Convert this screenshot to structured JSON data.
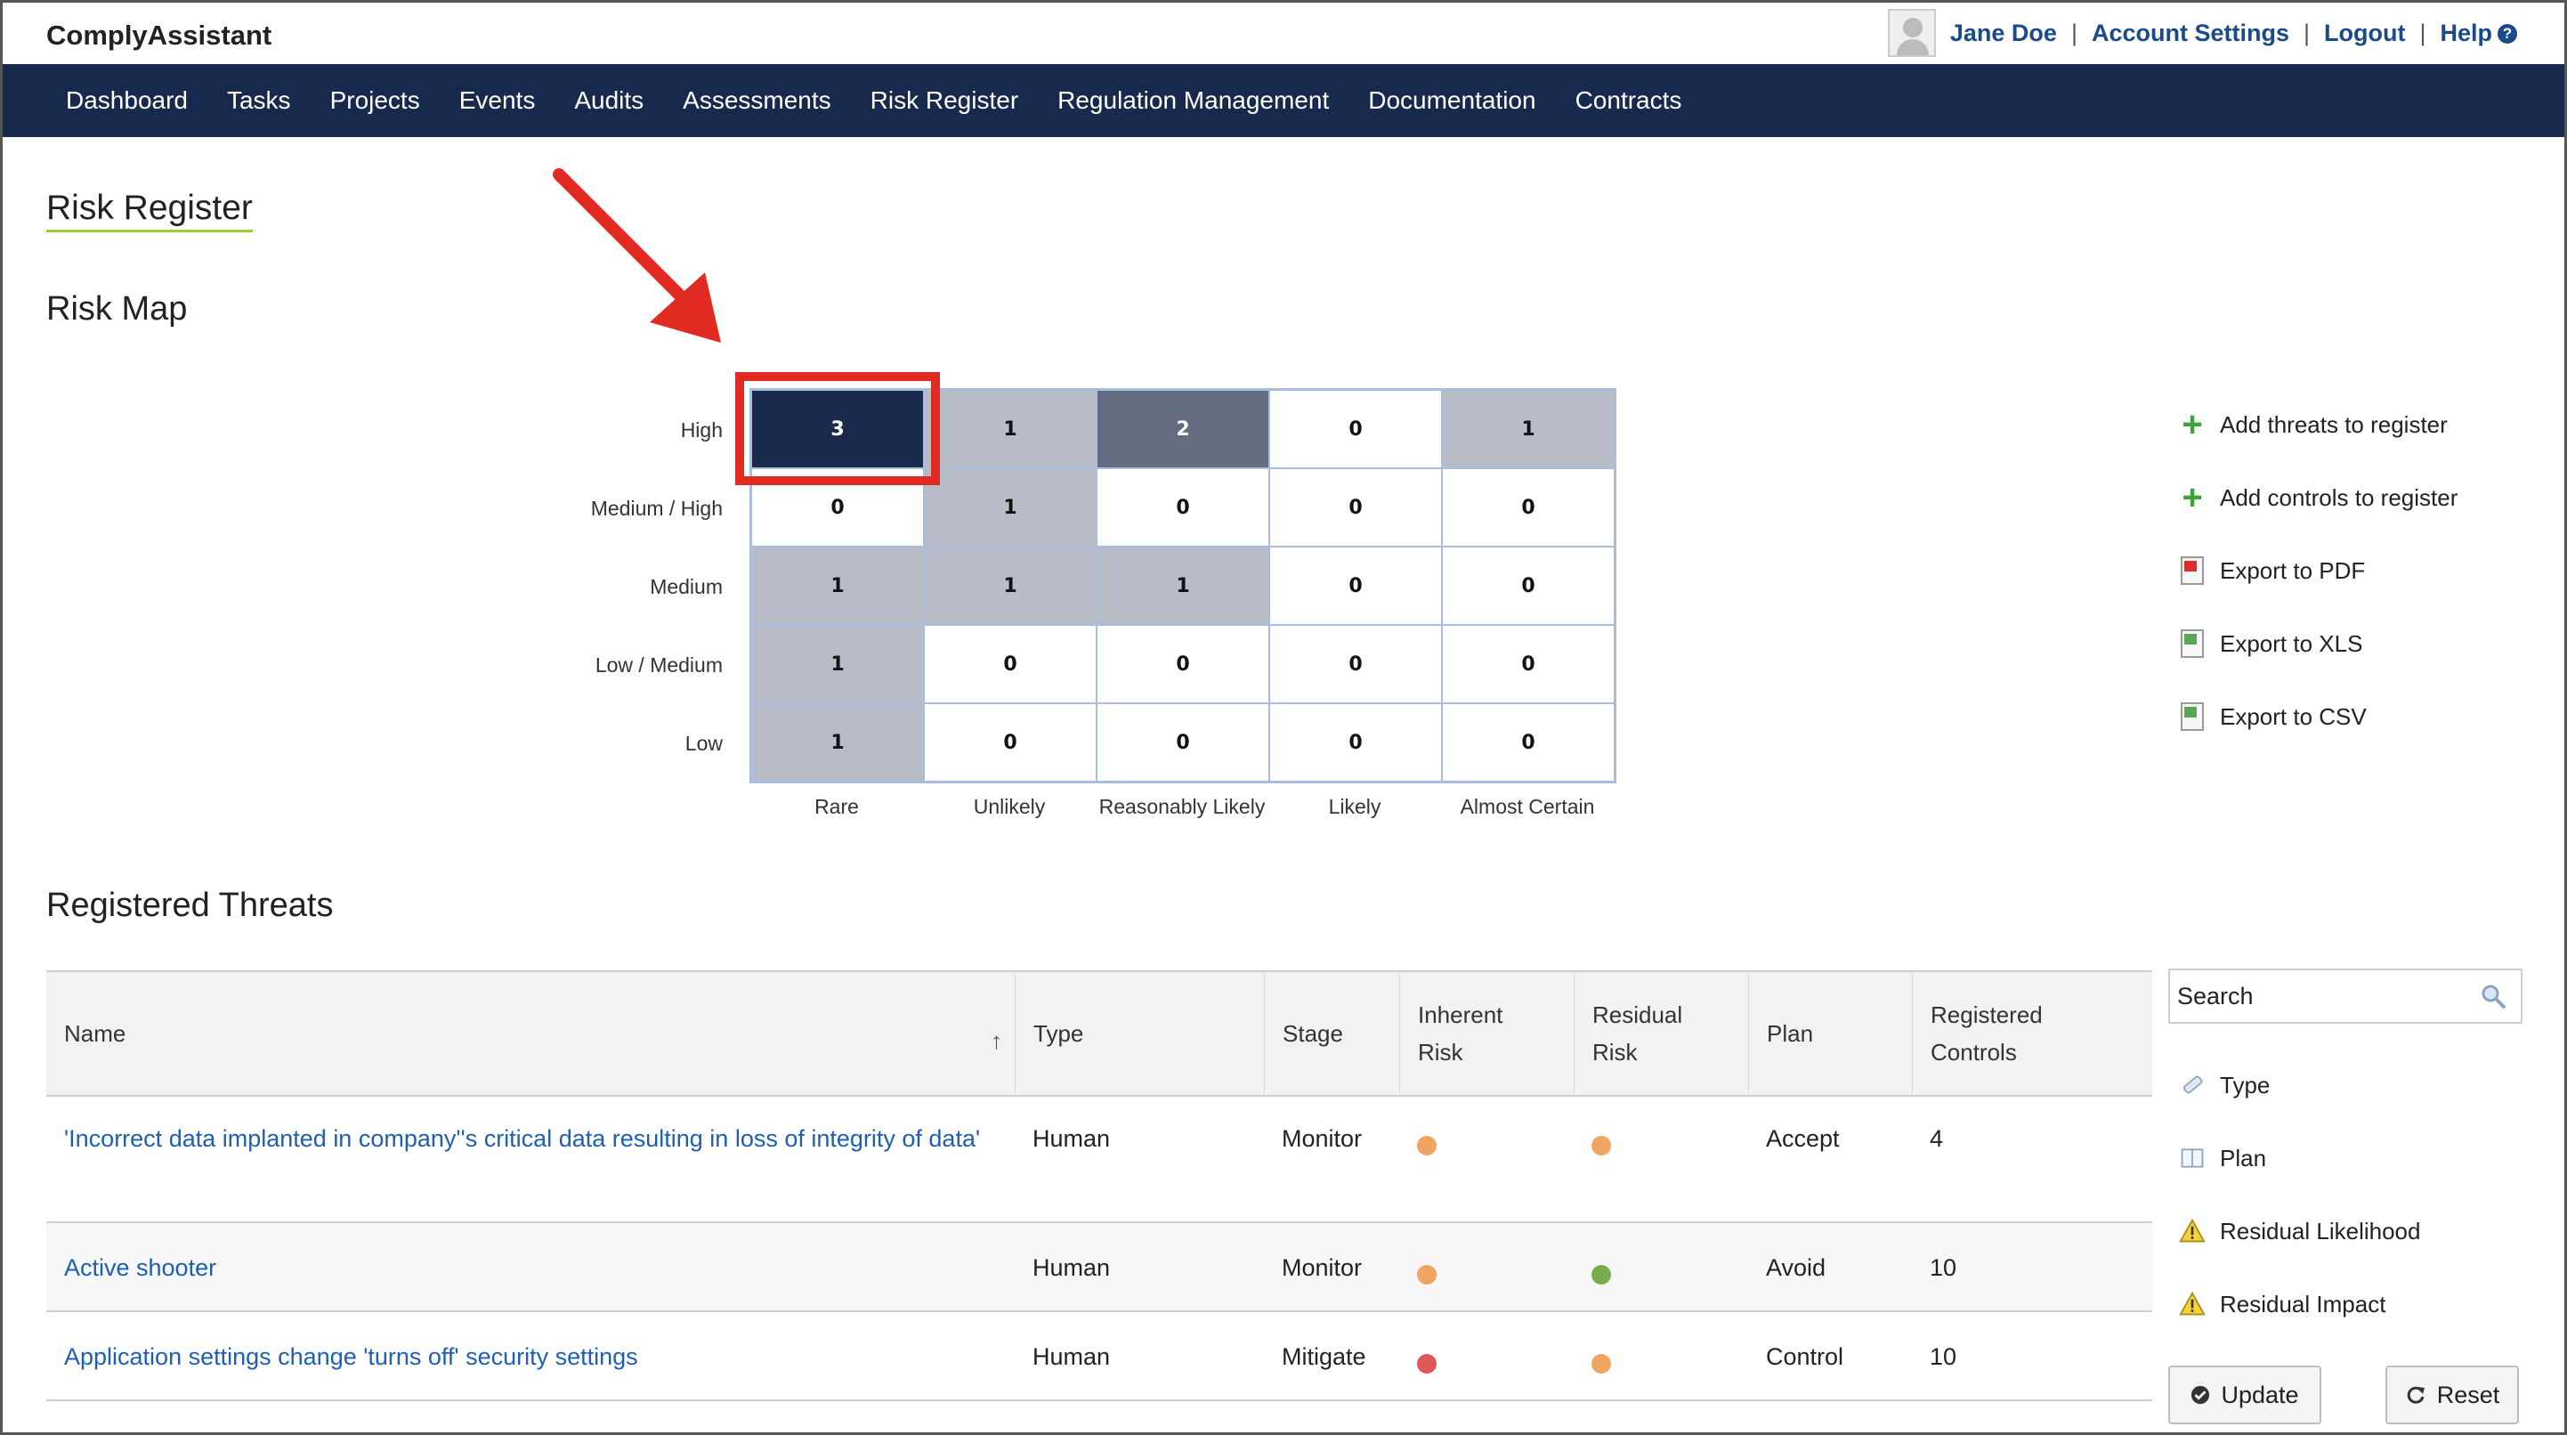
{
  "app": {
    "brand": "ComplyAssistant"
  },
  "user": {
    "name": "Jane Doe",
    "account_settings": "Account Settings",
    "logout": "Logout",
    "help": "Help",
    "sep": "|"
  },
  "nav": [
    "Dashboard",
    "Tasks",
    "Projects",
    "Events",
    "Audits",
    "Assessments",
    "Risk Register",
    "Regulation Management",
    "Documentation",
    "Contracts"
  ],
  "page": {
    "title": "Risk Register",
    "risk_map_title": "Risk Map",
    "threats_title": "Registered Threats"
  },
  "risk_map": {
    "rows": [
      "High",
      "Medium / High",
      "Medium",
      "Low / Medium",
      "Low"
    ],
    "cols": [
      "Rare",
      "Unlikely",
      "Reasonably Likely",
      "Likely",
      "Almost Certain"
    ],
    "values": [
      [
        "3",
        "1",
        "2",
        "0",
        "1"
      ],
      [
        "0",
        "1",
        "0",
        "0",
        "0"
      ],
      [
        "1",
        "1",
        "1",
        "0",
        "0"
      ],
      [
        "1",
        "0",
        "0",
        "0",
        "0"
      ],
      [
        "1",
        "0",
        "0",
        "0",
        "0"
      ]
    ],
    "shades": [
      [
        "#1a2a4c",
        "#b8bcc7",
        "#636c80",
        "#ffffff",
        "#b8bcc7"
      ],
      [
        "#ffffff",
        "#b8bcc7",
        "#ffffff",
        "#ffffff",
        "#ffffff"
      ],
      [
        "#b8bcc7",
        "#b8bcc7",
        "#b8bcc7",
        "#ffffff",
        "#ffffff"
      ],
      [
        "#b8bcc7",
        "#ffffff",
        "#ffffff",
        "#ffffff",
        "#ffffff"
      ],
      [
        "#b8bcc7",
        "#ffffff",
        "#ffffff",
        "#ffffff",
        "#ffffff"
      ]
    ],
    "highlight_color": "#e12b22"
  },
  "actions": [
    "Add threats to register",
    "Add controls to register",
    "Export to PDF",
    "Export to XLS",
    "Export to CSV"
  ],
  "table": {
    "headers": [
      "Name",
      "Type",
      "Stage",
      "Inherent Risk",
      "Residual Risk",
      "Plan",
      "Registered Controls"
    ],
    "rows": [
      {
        "name": "'Incorrect data implanted in company''s critical data resulting in loss of integrity of data'",
        "type": "Human",
        "stage": "Monitor",
        "inherent": "#f0a562",
        "residual": "#f0a562",
        "plan": "Accept",
        "controls": "4"
      },
      {
        "name": "Active shooter",
        "type": "Human",
        "stage": "Monitor",
        "inherent": "#f0a562",
        "residual": "#77ad4e",
        "plan": "Avoid",
        "controls": "10"
      },
      {
        "name": "Application settings change 'turns off' security settings",
        "type": "Human",
        "stage": "Mitigate",
        "inherent": "#e0555a",
        "residual": "#f0a562",
        "plan": "Control",
        "controls": "10"
      }
    ]
  },
  "filters": {
    "search_placeholder": "Search",
    "items": [
      "Type",
      "Plan",
      "Residual Likelihood",
      "Residual Impact"
    ],
    "update": "Update",
    "reset": "Reset"
  }
}
